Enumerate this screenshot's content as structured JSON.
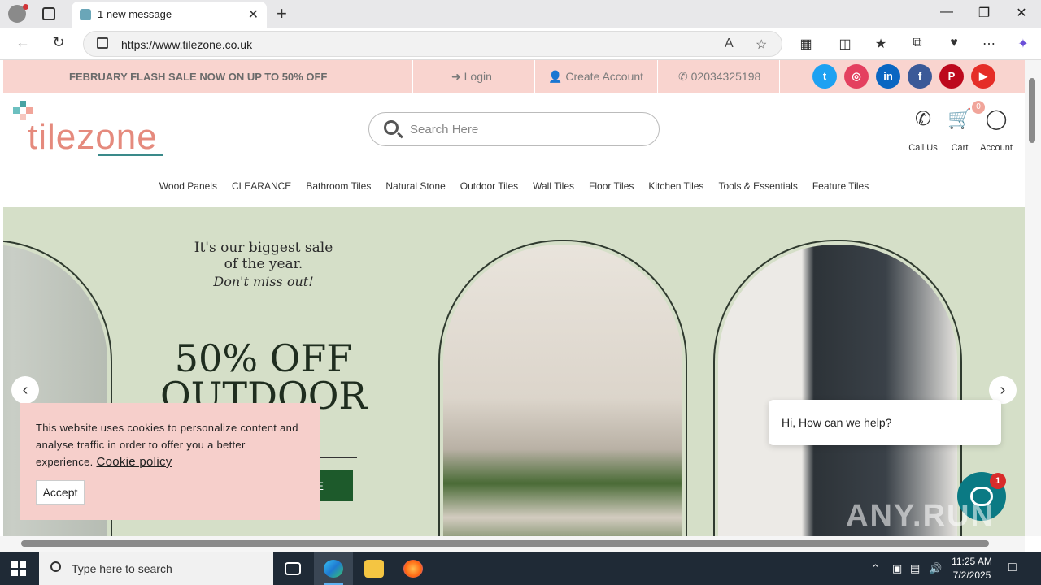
{
  "browser": {
    "tab_title": "1 new message",
    "url": "https://www.tilezone.co.uk",
    "new_tab_label": "+",
    "close_tab_label": "✕"
  },
  "promo": {
    "message": "FEBRUARY FLASH SALE NOW ON UP TO 50% OFF",
    "login": "Login",
    "create_account": "Create Account",
    "phone": "02034325198",
    "social": [
      {
        "name": "twitter",
        "glyph": "t",
        "color": "#1da1f2"
      },
      {
        "name": "instagram",
        "glyph": "◎",
        "color": "#e4405f"
      },
      {
        "name": "linkedin",
        "glyph": "in",
        "color": "#0a66c2"
      },
      {
        "name": "facebook",
        "glyph": "f",
        "color": "#3b5998"
      },
      {
        "name": "pinterest",
        "glyph": "P",
        "color": "#bd081c"
      },
      {
        "name": "youtube",
        "glyph": "▶",
        "color": "#e52d27"
      }
    ]
  },
  "header": {
    "logo_text": "tilezone",
    "search_placeholder": "Search Here",
    "call_label": "Call Us",
    "cart_label": "Cart",
    "cart_count": "0",
    "account_label": "Account"
  },
  "nav": [
    "Wood Panels",
    "CLEARANCE",
    "Bathroom Tiles",
    "Natural Stone",
    "Outdoor Tiles",
    "Wall Tiles",
    "Floor Tiles",
    "Kitchen Tiles",
    "Tools & Essentials",
    "Feature Tiles"
  ],
  "hero": {
    "line1": "It's our biggest sale",
    "line2": "of the year.",
    "line3": "Don't miss out!",
    "headline1": "50% OFF",
    "headline2": "OUTDOOR",
    "button_partial": "E"
  },
  "cookie": {
    "text": "This website uses cookies to personalize content and analyse traffic in order to offer you a better experience.",
    "policy_link": "Cookie policy",
    "accept": "Accept"
  },
  "chat": {
    "greeting": "Hi, How can we help?",
    "badge": "1"
  },
  "watermark": "ANY.RUN",
  "taskbar": {
    "search_placeholder": "Type here to search",
    "time": "11:25 AM",
    "date": "7/2/2025"
  },
  "colors": {
    "promo_bg": "#f9d4cf",
    "hero_bg": "#d5dfc8",
    "brand": "#e58a7d",
    "cta": "#1d5a2b",
    "chat": "#0b7a84"
  }
}
